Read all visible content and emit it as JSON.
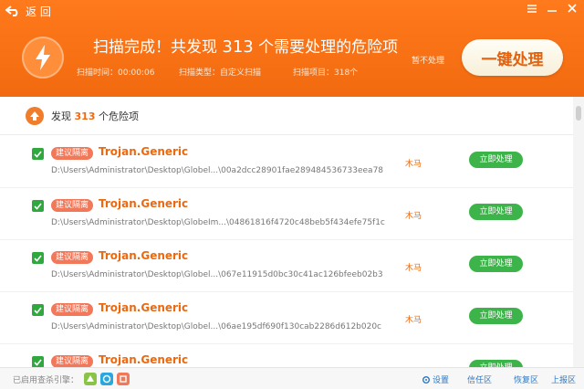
{
  "header": {
    "back_label": "返 回",
    "headline_prefix": "扫描完成！共发现 ",
    "headline_count": "313",
    "headline_suffix": " 个需要处理的危险项",
    "scan_time": "扫描时间：00:00:06",
    "scan_type": "扫描类型：自定义扫描",
    "scan_items": "扫描项目：318个",
    "ignore_label": "暂不处理",
    "oneclick_label": "一键处理"
  },
  "summary": {
    "prefix": "发现 ",
    "count": "313",
    "suffix": " 个危险项"
  },
  "items": [
    {
      "tag": "建议隔离",
      "name": "Trojan.Generic",
      "path": "D:\\Users\\Administrator\\Desktop\\Globel...\\00a2dcc28901fae289484536733eea78",
      "type": "木马",
      "action": "立即处理",
      "checked": true
    },
    {
      "tag": "建议隔离",
      "name": "Trojan.Generic",
      "path": "D:\\Users\\Administrator\\Desktop\\GlobeIm...\\04861816f4720c48beb5f434efe75f1c",
      "type": "木马",
      "action": "立即处理",
      "checked": true
    },
    {
      "tag": "建议隔离",
      "name": "Trojan.Generic",
      "path": "D:\\Users\\Administrator\\Desktop\\Globel...\\067e11915d0bc30c41ac126bfeeb02b3",
      "type": "木马",
      "action": "立即处理",
      "checked": true
    },
    {
      "tag": "建议隔离",
      "name": "Trojan.Generic",
      "path": "D:\\Users\\Administrator\\Desktop\\Globel...\\06ae195df690f130cab2286d612b020c",
      "type": "木马",
      "action": "立即处理",
      "checked": true
    },
    {
      "tag": "建议隔离",
      "name": "Trojan.Generic",
      "path": "",
      "type": "",
      "action": "立即处理",
      "checked": true
    }
  ],
  "footer": {
    "engines_label": "已启用查杀引擎：",
    "settings": "设置",
    "trust_zone": "信任区",
    "restore_zone": "恢复区",
    "report": "上报区"
  },
  "colors": {
    "header_orange": "#f26a0f",
    "accent_orange": "#ea6a12",
    "tag_red": "#f2785a",
    "action_green": "#3db44a"
  }
}
